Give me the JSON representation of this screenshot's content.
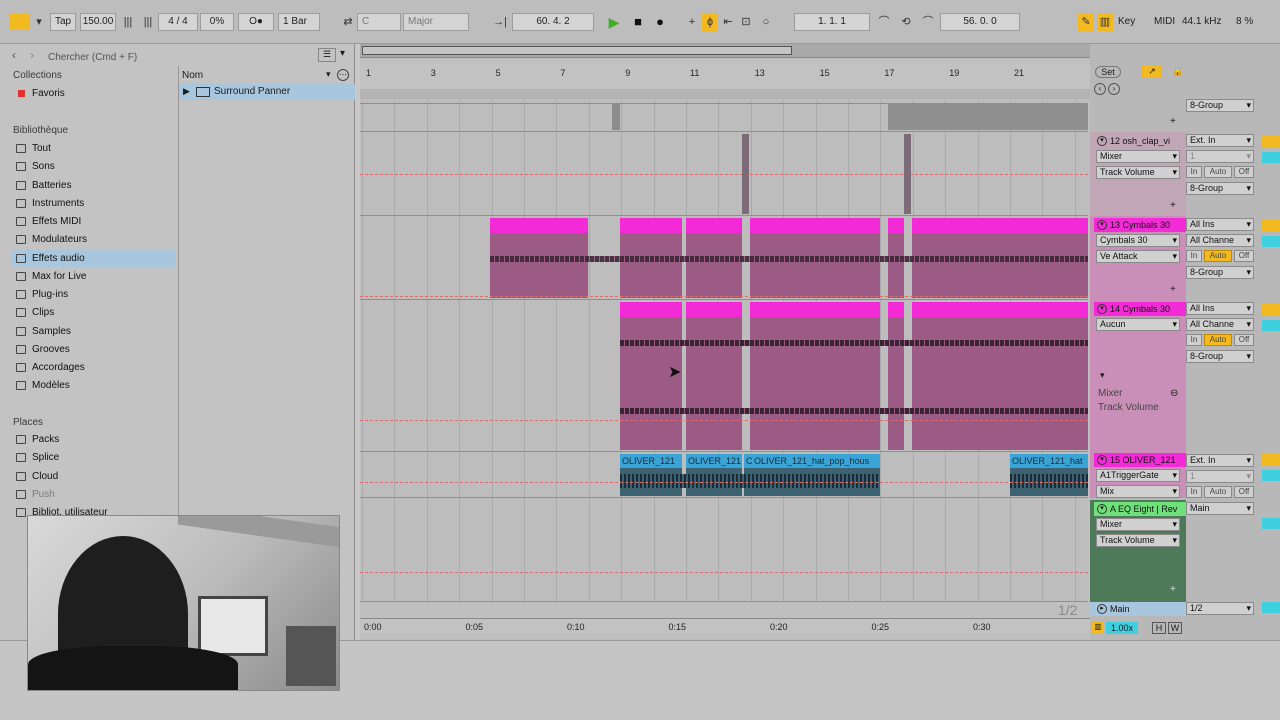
{
  "topbar": {
    "tap": "Tap",
    "tempo": "150.00",
    "signature": "4 / 4",
    "cpu_pct": "0%",
    "metro": "O●",
    "quantize": "1 Bar",
    "key": "C",
    "scale": "Major",
    "position": "60.  4.  2",
    "loop_start": "1.  1.  1",
    "loop_len": "56.  0.  0",
    "key_btn": "Key",
    "midi_btn": "MIDI",
    "sample_rate": "44.1 kHz",
    "cpu_load": "8 %"
  },
  "browser": {
    "search_placeholder": "Chercher (Cmd + F)",
    "collections_label": "Collections",
    "favorites": "Favoris",
    "library_label": "Bibliothèque",
    "library_items": [
      "Tout",
      "Sons",
      "Batteries",
      "Instruments",
      "Effets MIDI",
      "Modulateurs",
      "Effets audio",
      "Max for Live",
      "Plug-ins",
      "Clips",
      "Samples",
      "Grooves",
      "Accordages",
      "Modèles"
    ],
    "places_label": "Places",
    "places_items": [
      "Packs",
      "Splice",
      "Cloud",
      "Push",
      "Bibliot. utilisateur"
    ],
    "column_name": "Nom",
    "file_item": "Surround Panner",
    "selected_index": 6
  },
  "ruler": {
    "bars": [
      "1",
      "3",
      "5",
      "7",
      "9",
      "11",
      "13",
      "15",
      "17",
      "19",
      "21"
    ],
    "times": [
      "0:00",
      "0:05",
      "0:10",
      "0:15",
      "0:20",
      "0:25",
      "0:30"
    ],
    "set_btn": "Set",
    "page": "1/2"
  },
  "tracks": {
    "t12": {
      "name": "12 osh_clap_vi",
      "in": "Ext. In",
      "ch": "1",
      "mix": "Mixer",
      "auto": "Track Volume",
      "group": "8-Group"
    },
    "t13": {
      "name": "13 Cymbals 30",
      "in": "All Ins",
      "ch": "All Channe",
      "dev": "Cymbals 30",
      "auto": "Ve Attack",
      "group": "8-Group"
    },
    "t14": {
      "name": "14 Cymbals 30",
      "in": "All Ins",
      "ch": "All Channe",
      "dev": "Aucun",
      "group": "8-Group",
      "mixer": "Mixer",
      "auto": "Track Volume"
    },
    "t15": {
      "name": "15 OLIVER_121",
      "in": "Ext. In",
      "ch": "1",
      "dev": "A1TriggerGate",
      "auto": "Mix"
    },
    "ta": {
      "name": "A EQ Eight | Rev",
      "out": "Main",
      "mix": "Mixer",
      "auto": "Track Volume"
    },
    "main": {
      "name": "Main",
      "route": "1/2"
    },
    "group_top": "8-Group"
  },
  "clips": {
    "oliver_labels": [
      "OLIVER_121",
      "OLIVER_121",
      "C",
      "OLIVER_121_hat_pop_hous",
      "OLIVER_121_hat"
    ]
  },
  "buttons": {
    "in": "In",
    "auto": "Auto",
    "off": "Off",
    "zoom": "1.00x",
    "h": "H",
    "w": "W"
  }
}
